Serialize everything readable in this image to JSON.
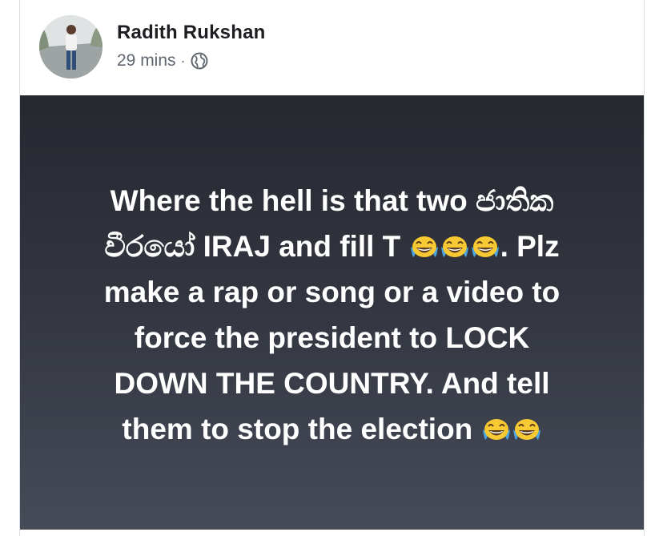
{
  "post": {
    "author": "Radith Rukshan",
    "time": "29 mins",
    "separator": "·",
    "privacy_icon": "globe-icon",
    "text_lines": [
      "Where the hell is that two ජාතික",
      "වීරයෝ IRAJ and fill T ",
      ". Plz",
      "make a rap or song or a video to",
      "force the president  to LOCK",
      "DOWN THE COUNTRY. And tell",
      "them to stop the election  "
    ],
    "emoji": "face-with-tears-of-joy-icon",
    "background_colors": [
      "#262830",
      "#464b58"
    ]
  }
}
